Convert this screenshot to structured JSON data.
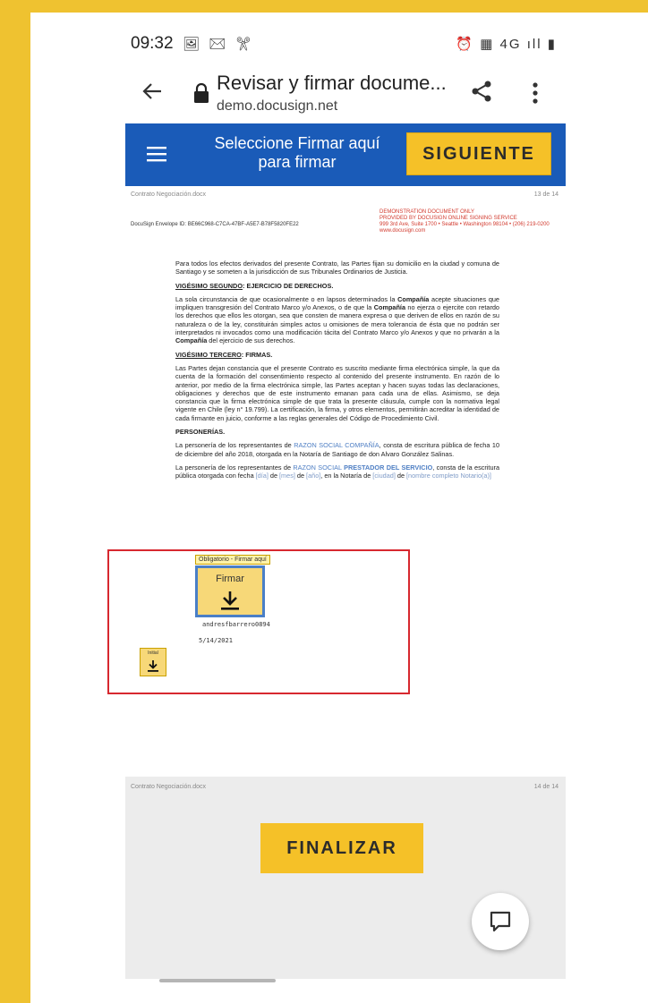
{
  "status_bar": {
    "time": "09:32",
    "left_icons": "🖼 ✉ ✂",
    "right_icons": "⏰ ▦ 4G ıll ▮"
  },
  "browser": {
    "page_title": "Revisar y firmar docume...",
    "url": "demo.docusign.net"
  },
  "docusign_header": {
    "message": "Seleccione Firmar aquí para firmar",
    "next_button": "SIGUIENTE"
  },
  "document": {
    "file_name": "Contrato Negociación.docx",
    "page_indicator": "13 de 14",
    "envelope_id": "DocuSign Envelope ID: BE66C968-C7CA-47BF-A5E7-B78F5820FE22",
    "demo_notice": {
      "line1": "DEMONSTRATION DOCUMENT ONLY",
      "line2": "PROVIDED BY DOCUSIGN ONLINE SIGNING SERVICE",
      "line3": "999 3rd Ave, Suite 1700 • Seattle • Washington 98104 • (206) 219-0200",
      "line4": "www.docusign.com"
    },
    "para1": "Para todos los efectos derivados del presente Contrato, las Partes fijan su domicilio en la ciudad y comuna de Santiago y se someten a la jurisdicción de sus Tribunales Ordinarios de Justicia.",
    "section1_title": "VIGÉSIMO SEGUNDO",
    "section1_rest": ": EJERCICIO DE DERECHOS.",
    "para2a": "La sola circunstancia de que ocasionalmente o en lapsos determinados la ",
    "company": "Compañía",
    "para2b": " acepte situaciones que impliquen transgresión del Contrato Marco y/o Anexos, o de que la ",
    "para2c": " no ejerza o ejercite con retardo los derechos que ellos les otorgan, sea que consten de manera expresa o que deriven de ellos en razón de su naturaleza o de la ley, constituirán simples actos u omisiones de mera tolerancia de ésta que no podrán ser interpretados ni invocados como una modificación tácita del Contrato Marco y/o Anexos y que no privarán a la ",
    "para2d": " del ejercicio de sus derechos.",
    "section2_title": "VIGÉSIMO TERCERO",
    "section2_rest": ": FIRMAS.",
    "para3": "Las Partes dejan constancia que el presente Contrato es suscrito mediante firma electrónica simple, la que da cuenta de la formación del consentimiento respecto al contenido del presente instrumento. En razón de lo anterior, por medio de la firma electrónica simple, las Partes aceptan y hacen suyas todas las declaraciones, obligaciones y derechos que de este instrumento emanan para cada una de ellas. Asimismo, se deja constancia que la firma electrónica simple de que trata la presente cláusula, cumple con la normativa legal vigente en Chile (ley n° 19.799). La certificación, la firma, y otros elementos, permitirán acreditar la identidad de cada firmante en juicio, conforme a las reglas generales del Código de Procedimiento Civil.",
    "section3_title": "PERSONERÍAS.",
    "para4a": "La personería de los representantes de ",
    "razon_social_compania": "RAZON SOCIAL COMPAÑÍA",
    "para4b": ", consta de escritura pública de fecha 10 de diciembre del año 2018, otorgada en la Notaría de Santiago de don Alvaro González Salinas.",
    "para5a": "La personería de los representantes de ",
    "razon_social": "RAZON SOCIAL",
    "prestador": "PRESTADOR DEL SERVICIO",
    "para5b": ", consta de la escritura pública otorgada con fecha ",
    "dia": "[día]",
    "de1": " de ",
    "mes": "[mes]",
    "de2": " de ",
    "anio": "[año]",
    "para5c": ", en la Notaría de ",
    "ciudad": "[ciudad]",
    "de3": " de ",
    "nombre": "[nombre",
    "nombre_notario": "completo Notario(a)]"
  },
  "signing": {
    "required_tag": "Obligatorio - Firmar aquí",
    "sign_label": "Firmar",
    "signer_name": "andresfbarrero0894",
    "date": "5/14/2021",
    "initial_label": "Initial"
  },
  "next_page": {
    "file_name": "Contrato Negociación.docx",
    "page_indicator": "14 de 14"
  },
  "finish_button": "FINALIZAR",
  "colors": {
    "frame": "#efc230",
    "header_blue": "#1a5bb8",
    "button_yellow": "#f5c128",
    "highlight_red": "#d7282f"
  }
}
